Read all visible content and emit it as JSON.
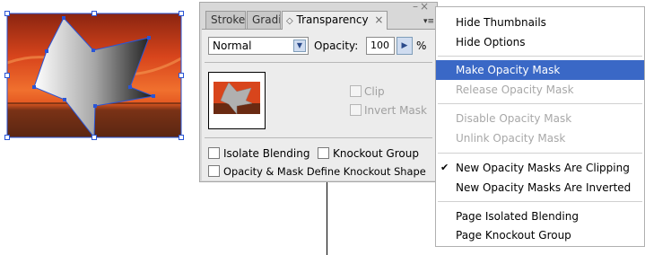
{
  "panel": {
    "tabs": [
      {
        "label": "Stroke",
        "icon": "collapse-icon"
      },
      {
        "label": "Gradient",
        "icon": "collapse-icon"
      },
      {
        "label": "Transparency",
        "icon": "collapse-icon",
        "active": true
      }
    ],
    "close_glyph": "×",
    "window_controls": "–×",
    "blend_mode": "Normal",
    "opacity_label": "Opacity:",
    "opacity_value": "100",
    "opacity_unit": "%",
    "clip_label": "Clip",
    "invert_mask_label": "Invert Mask",
    "isolate_blending_label": "Isolate Blending",
    "knockout_group_label": "Knockout Group",
    "opacity_mask_label": "Opacity & Mask Define Knockout Shape"
  },
  "menu": {
    "items": [
      {
        "label": "Hide Thumbnails",
        "state": "normal"
      },
      {
        "label": "Hide Options",
        "state": "normal"
      },
      {
        "label": "Make Opacity Mask",
        "state": "highlighted"
      },
      {
        "label": "Release Opacity Mask",
        "state": "disabled"
      },
      {
        "label": "Disable Opacity Mask",
        "state": "disabled"
      },
      {
        "label": "Unlink Opacity Mask",
        "state": "disabled"
      },
      {
        "label": "New Opacity Masks Are Clipping",
        "state": "checked"
      },
      {
        "label": "New Opacity Masks Are Inverted",
        "state": "normal"
      },
      {
        "label": "Page Isolated Blending",
        "state": "normal"
      },
      {
        "label": "Page Knockout Group",
        "state": "normal"
      }
    ],
    "check_glyph": "✔"
  },
  "colors": {
    "selection_blue": "#3a68c6",
    "anchor_blue": "#2a55d6",
    "sunset_orange": "#e0502a"
  }
}
